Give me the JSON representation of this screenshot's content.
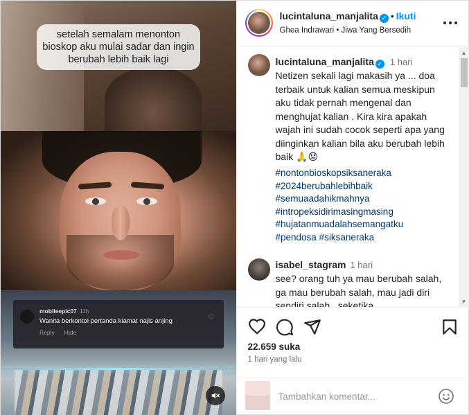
{
  "media": {
    "overlay_caption": "setelah semalam menonton bioskop aku mulai sadar dan ingin berubah lebih baik lagi",
    "tiktok_comment": {
      "username": "mobileepic07",
      "time": "11h",
      "text": "Wanita berkontol pertanda kiamat najis anjing",
      "reply_label": "Reply",
      "hide_label": "Hide"
    },
    "mute_icon": "speaker-muted-icon"
  },
  "header": {
    "username": "lucintaluna_manjalita",
    "verified_icon": "verified-badge-icon",
    "separator": "•",
    "follow_label": "Ikuti",
    "audio_line": "Ghea Indrawari • Jiwa Yang Bersedih",
    "more_icon": "more-options-icon"
  },
  "caption": {
    "username": "lucintaluna_manjalita",
    "time": "1 hari",
    "text": "Netizen sekali lagi makasih ya ... doa terbaik untuk kalian semua meskipun aku tidak pernah mengenal dan menghujat kalian . Kira kira apakah wajah ini sudah cocok seperti apa yang diinginkan kalian bila aku berubah lebih baik 🙏😟",
    "hashtags": [
      "#nontonbioskopsiksaneraka",
      "#2024berubahlebihbaik",
      "#semuaadahikmahnya",
      "#intropeksidirimasingmasing",
      "#hujatanmuadalahsemangatku",
      "#pendosa #siksaneraka"
    ]
  },
  "comment": {
    "username": "isabel_stagram",
    "time": "1 hari",
    "text": "see? orang tuh ya mau berubah salah, ga mau berubah salah, mau jadi diri sendiri salah.. seketika"
  },
  "actions": {
    "like_icon": "heart-icon",
    "comment_icon": "comment-bubble-icon",
    "share_icon": "share-paper-plane-icon",
    "save_icon": "bookmark-icon",
    "likes": "22.659 suka",
    "date": "1 hari yang lalu"
  },
  "add_comment": {
    "placeholder": "Tambahkan komentar...",
    "emoji_icon": "emoji-smiley-icon"
  },
  "colors": {
    "accent": "#0095f6",
    "hashtag": "#00376b",
    "muted_text": "#737373"
  }
}
